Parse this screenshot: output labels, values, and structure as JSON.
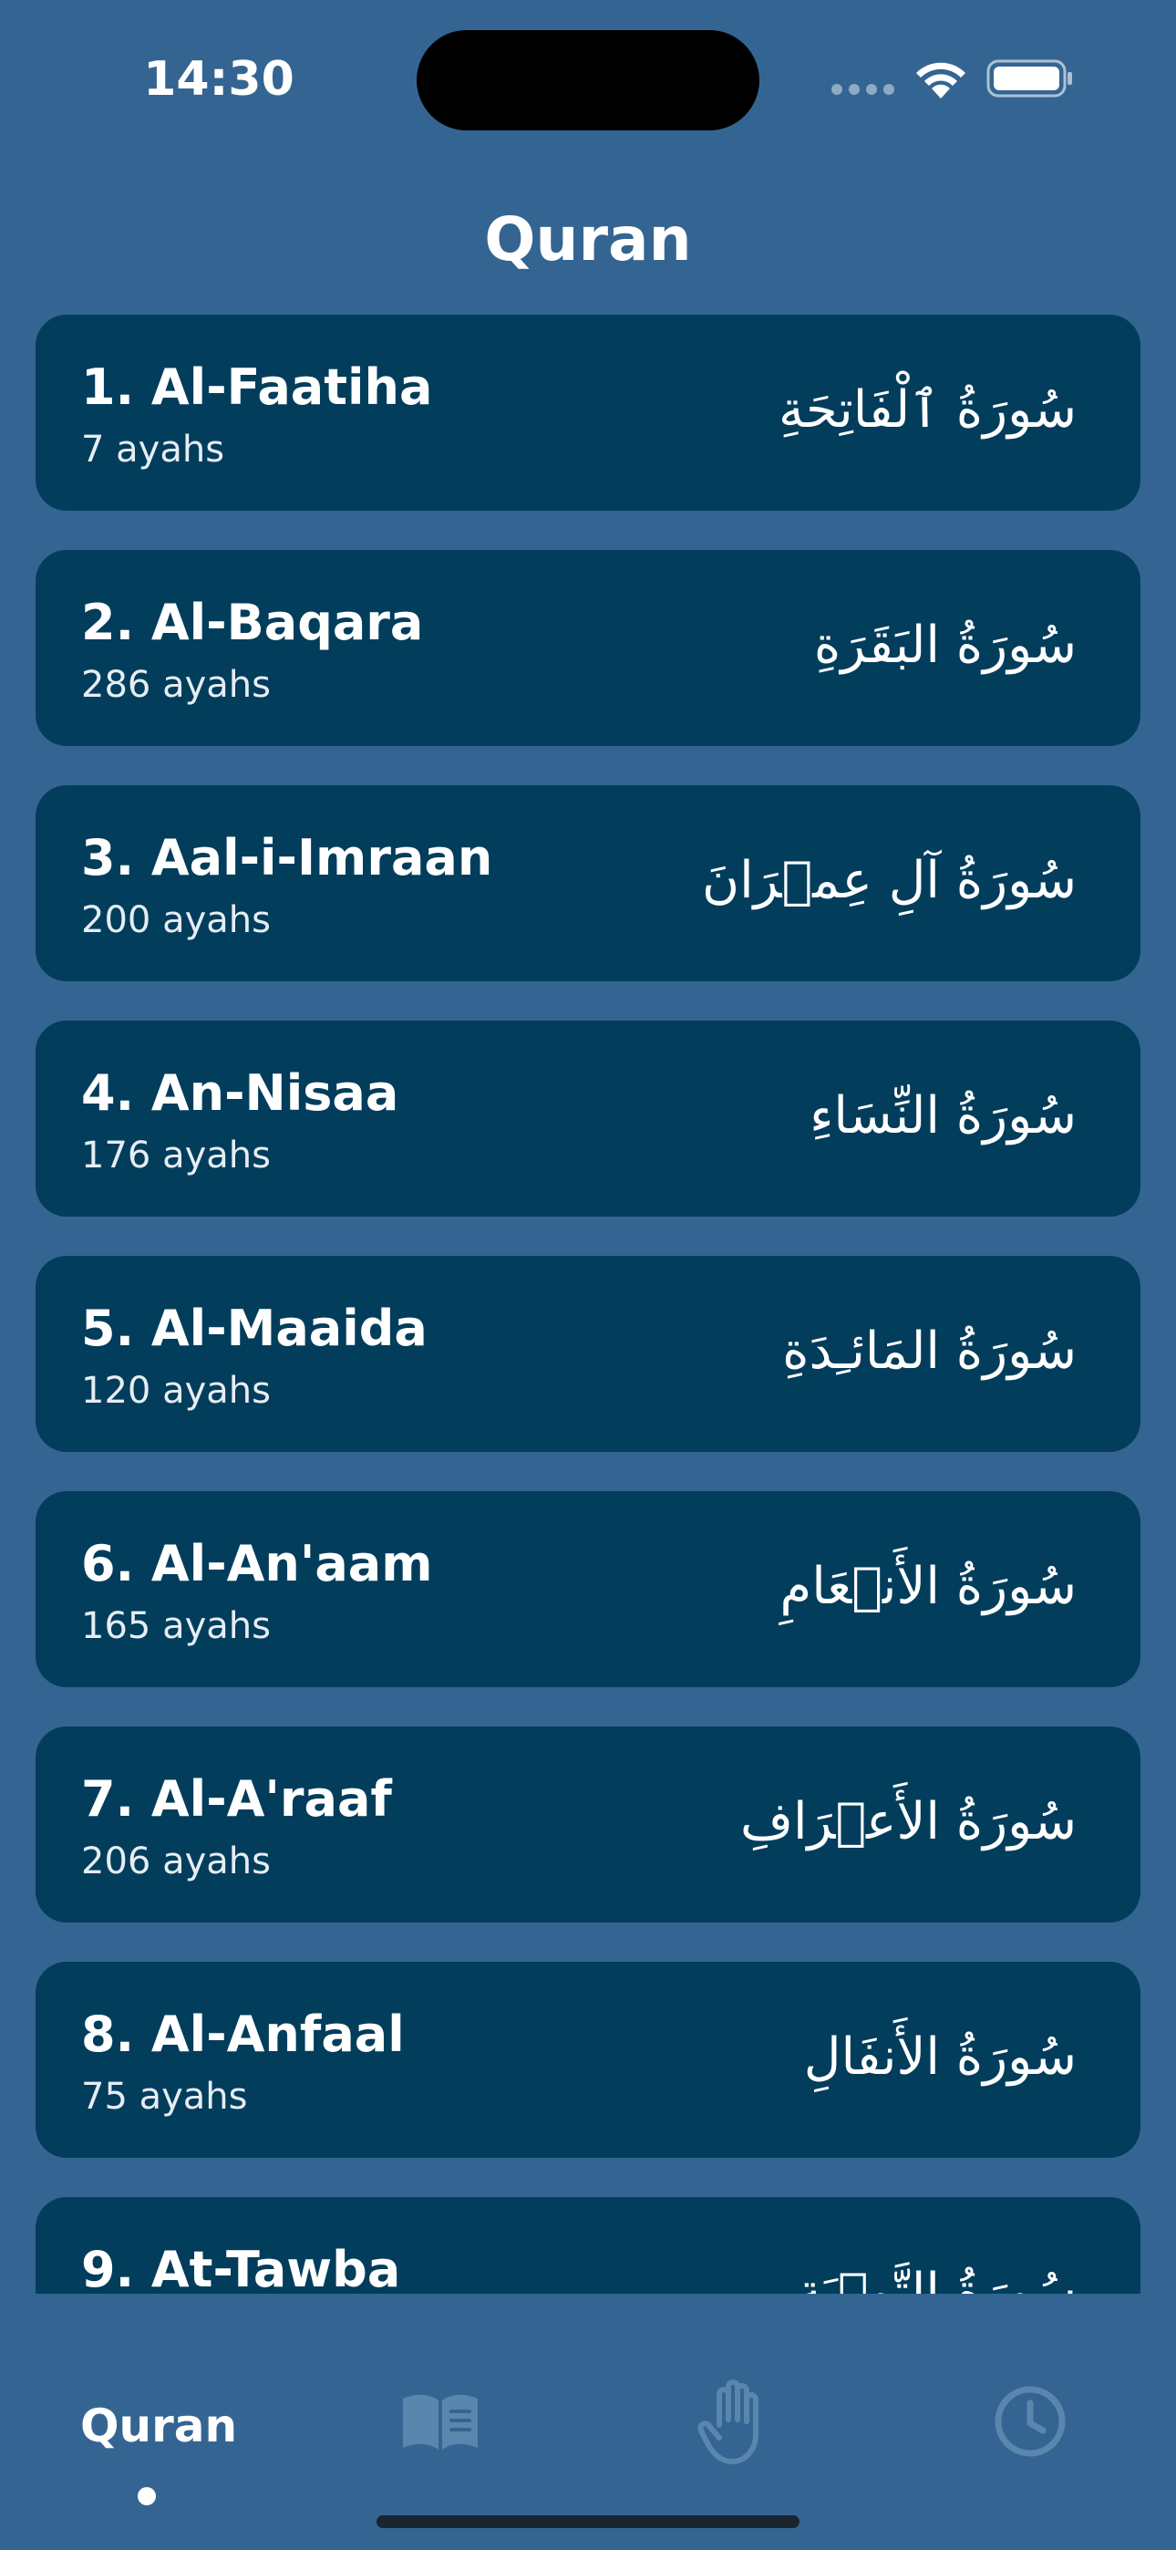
{
  "status_bar": {
    "time": "14:30"
  },
  "header": {
    "title": "Quran"
  },
  "surahs": [
    {
      "name": "1. Al-Faatiha",
      "ayahs": "7 ayahs",
      "arabic": "سُورَةُ ٱلْفَاتِحَةِ"
    },
    {
      "name": "2. Al-Baqara",
      "ayahs": "286 ayahs",
      "arabic": "سُورَةُ البَقَرَةِ"
    },
    {
      "name": "3. Aal-i-Imraan",
      "ayahs": "200 ayahs",
      "arabic": "سُورَةُ آلِ عِمۡرَانَ"
    },
    {
      "name": "4. An-Nisaa",
      "ayahs": "176 ayahs",
      "arabic": "سُورَةُ النِّسَاءِ"
    },
    {
      "name": "5. Al-Maaida",
      "ayahs": "120 ayahs",
      "arabic": "سُورَةُ المَائـِدَةِ"
    },
    {
      "name": "6. Al-An'aam",
      "ayahs": "165 ayahs",
      "arabic": "سُورَةُ الأَنۡعَامِ"
    },
    {
      "name": "7. Al-A'raaf",
      "ayahs": "206 ayahs",
      "arabic": "سُورَةُ الأَعۡرَافِ"
    },
    {
      "name": "8. Al-Anfaal",
      "ayahs": "75 ayahs",
      "arabic": "سُورَةُ الأَنفَالِ"
    },
    {
      "name": "9. At-Tawba",
      "ayahs": "",
      "arabic": "سُورَةُ التَّوۡبَةِ"
    }
  ],
  "tab_bar": {
    "tabs": [
      {
        "label": "Quran",
        "icon": "quran-text-tab",
        "active": true
      },
      {
        "label": "",
        "icon": "book-icon",
        "active": false
      },
      {
        "label": "",
        "icon": "hand-icon",
        "active": false
      },
      {
        "label": "",
        "icon": "clock-icon",
        "active": false
      }
    ]
  },
  "colors": {
    "background": "#346592",
    "card": "#023d5c",
    "text": "#ffffff",
    "inactive_icon": "#5a86ad"
  }
}
